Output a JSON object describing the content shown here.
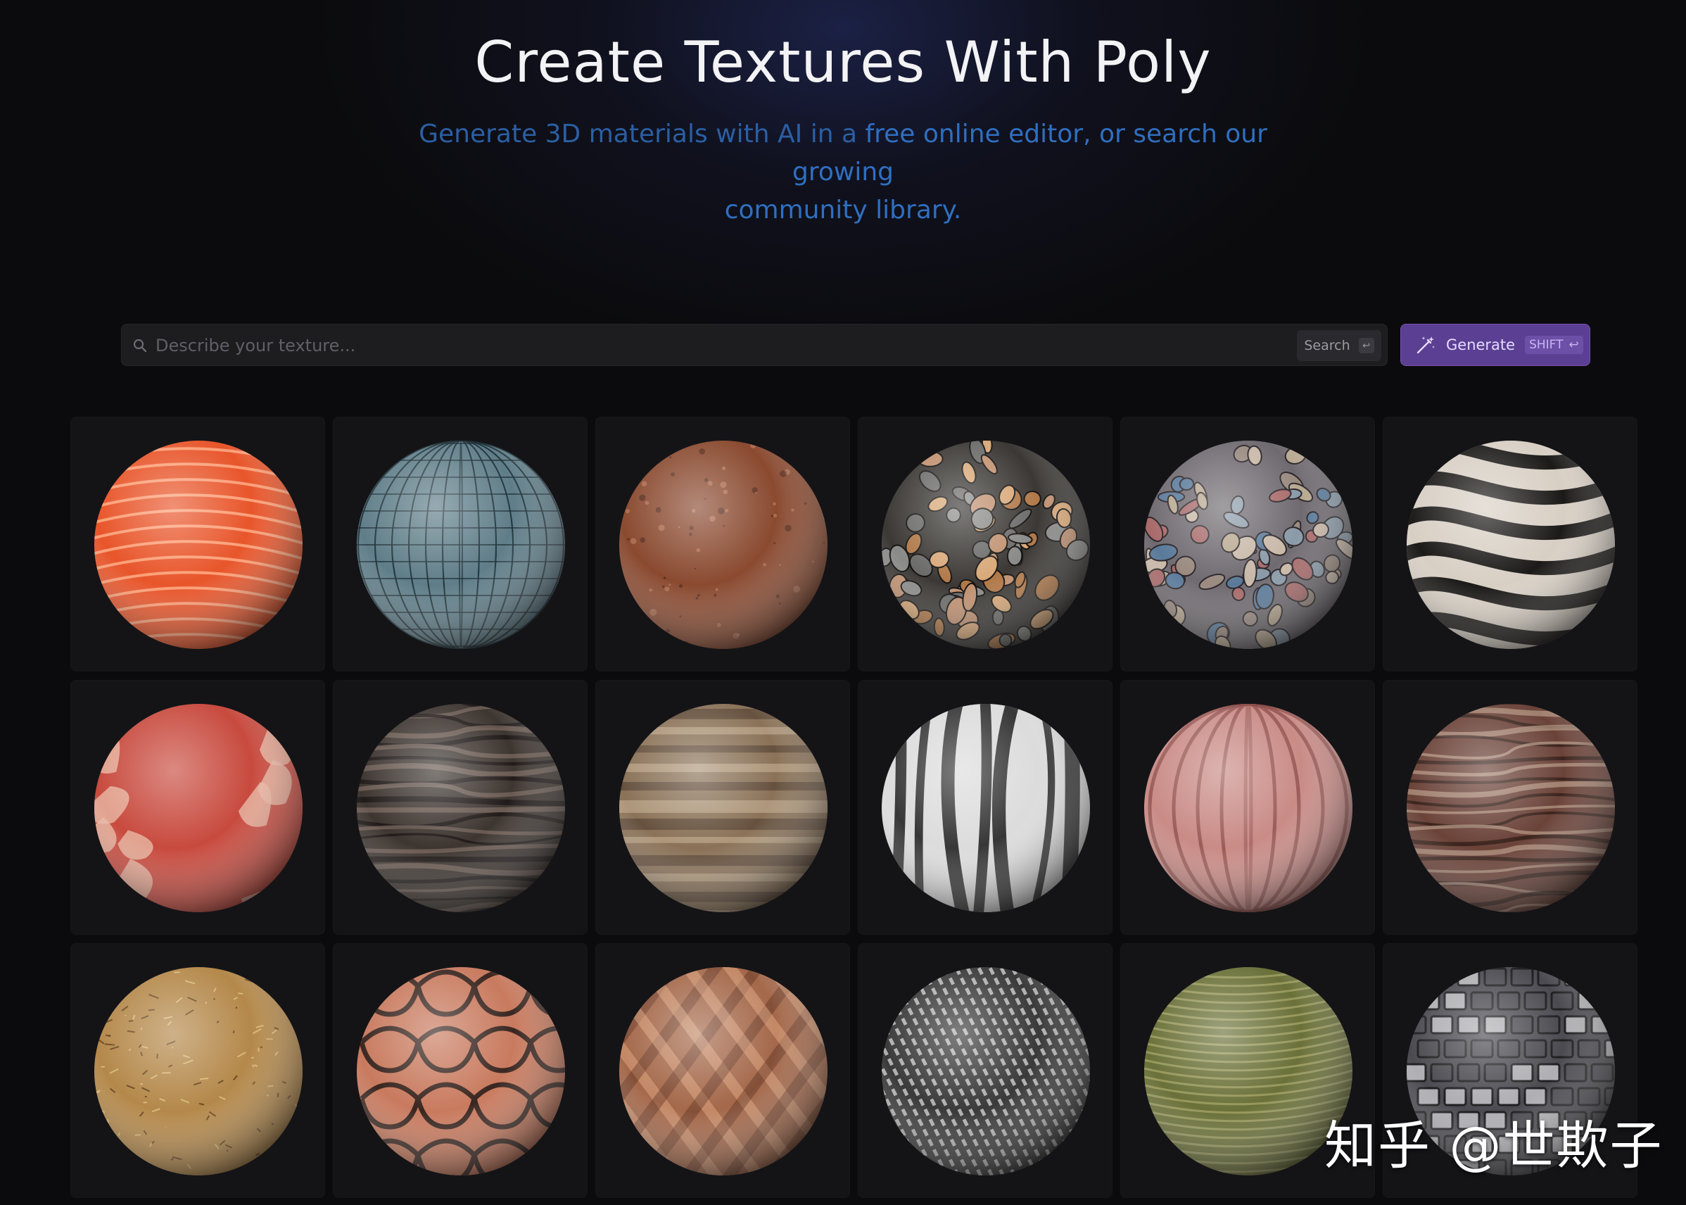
{
  "hero": {
    "title": "Create Textures With Poly",
    "subtitle_line1_dim": "Generate 3D materials with AI in a ",
    "subtitle_line1_link": "free online editor, or search our growing",
    "subtitle_line2": "community library."
  },
  "search": {
    "placeholder": "Describe your texture...",
    "value": "",
    "button_label": "Search",
    "button_key": "↩",
    "icon": "search-icon"
  },
  "generate": {
    "label": "Generate",
    "shortcut": "SHIFT",
    "shortcut_key": "↩",
    "icon": "magic-wand-icon",
    "color": "#5b3f92"
  },
  "materials": [
    {
      "name": "orange-striped-glossy",
      "base": "#e8552a",
      "light": "#ffb08a",
      "dark": "#7a1d08",
      "pattern": "stripes"
    },
    {
      "name": "blue-glass-tiles",
      "base": "#5f7d88",
      "light": "#d7e6ea",
      "dark": "#1e3038",
      "pattern": "tiles"
    },
    {
      "name": "brown-leather",
      "base": "#8a4a30",
      "light": "#c98a6a",
      "dark": "#3a1a10",
      "pattern": "noise"
    },
    {
      "name": "dark-pebbles",
      "base": "#3b3835",
      "light": "#b89a7a",
      "dark": "#141210",
      "pattern": "pebbles"
    },
    {
      "name": "colorful-stones",
      "base": "#6f6a70",
      "light": "#c6a7a0",
      "dark": "#2a2528",
      "pattern": "stones"
    },
    {
      "name": "zebra-mosaic",
      "base": "#d8cfc4",
      "light": "#f2ece4",
      "dark": "#1c1a18",
      "pattern": "zebra"
    },
    {
      "name": "peeling-red-paint",
      "base": "#c84a3e",
      "light": "#e8b8a4",
      "dark": "#6b2a22",
      "pattern": "peel"
    },
    {
      "name": "dark-volcanic-rock",
      "base": "#3d3530",
      "light": "#7a6a60",
      "dark": "#141010",
      "pattern": "rock"
    },
    {
      "name": "layered-sandstone",
      "base": "#8a7258",
      "light": "#d8c3a4",
      "dark": "#3a2a1e",
      "pattern": "layers"
    },
    {
      "name": "white-black-marble",
      "base": "#dcdcdc",
      "light": "#ffffff",
      "dark": "#1a1a1a",
      "pattern": "marble"
    },
    {
      "name": "pink-fabric-stripes",
      "base": "#c98b86",
      "light": "#efc2bd",
      "dark": "#8a4a48",
      "pattern": "vstripes"
    },
    {
      "name": "red-bark",
      "base": "#6a4238",
      "light": "#b89a86",
      "dark": "#2a1812",
      "pattern": "bark"
    },
    {
      "name": "dry-straw",
      "base": "#b4884a",
      "light": "#e2c282",
      "dark": "#5a3a18",
      "pattern": "straw"
    },
    {
      "name": "terracotta-tiles",
      "base": "#c87a5e",
      "light": "#f0b69a",
      "dark": "#3a2620",
      "pattern": "scallop"
    },
    {
      "name": "woven-wood",
      "base": "#a4684a",
      "light": "#e8b08a",
      "dark": "#4a2416",
      "pattern": "weave"
    },
    {
      "name": "carbon-fiber",
      "base": "#3a3a3a",
      "light": "#d8d8d8",
      "dark": "#0a0a0a",
      "pattern": "carbon"
    },
    {
      "name": "mossy-green-ribbed",
      "base": "#6a7038",
      "light": "#b8b878",
      "dark": "#2a2a14",
      "pattern": "ribs"
    },
    {
      "name": "dark-slate-scales",
      "base": "#4a4a50",
      "light": "#c8c8cc",
      "dark": "#141416",
      "pattern": "scales"
    }
  ],
  "watermark": {
    "text": "知乎 @世欺子"
  }
}
